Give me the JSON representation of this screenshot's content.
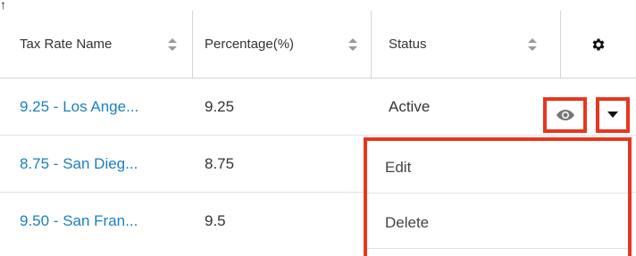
{
  "table": {
    "headers": [
      {
        "label": "Tax Rate Name"
      },
      {
        "label": "Percentage(%)"
      },
      {
        "label": "Status"
      }
    ],
    "settings_icon": "gear-icon",
    "rows": [
      {
        "name": "9.25 - Los Ange...",
        "percentage": "9.25",
        "status": "Active"
      },
      {
        "name": "8.75 - San Dieg...",
        "percentage": "8.75",
        "status": ""
      },
      {
        "name": "9.50 - San Fran...",
        "percentage": "9.5",
        "status": ""
      }
    ]
  },
  "row_actions": {
    "preview_icon": "eye-icon",
    "dropdown_icon": "caret-down-icon"
  },
  "action_menu": {
    "items": [
      {
        "label": "Edit"
      },
      {
        "label": "Delete"
      }
    ]
  },
  "colors": {
    "link": "#1a7fc1",
    "highlight": "#e8361e",
    "border": "#e2e2e2"
  }
}
